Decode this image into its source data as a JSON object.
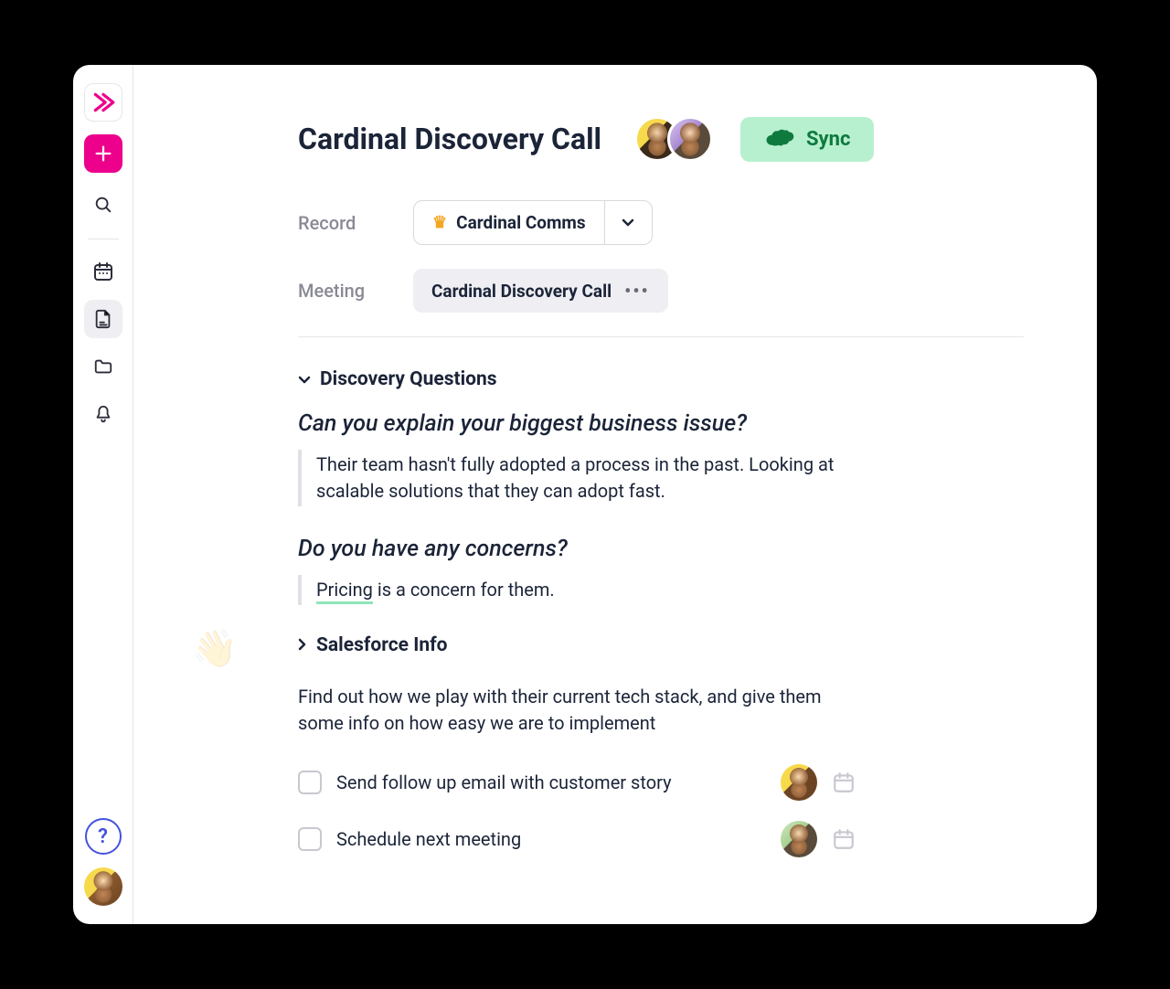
{
  "page": {
    "title": "Cardinal Discovery Call"
  },
  "sync": {
    "label": "Sync"
  },
  "meta": {
    "record_label": "Record",
    "record_value": "Cardinal Comms",
    "meeting_label": "Meeting",
    "meeting_value": "Cardinal Discovery Call"
  },
  "sections": {
    "discovery": {
      "title": "Discovery Questions",
      "q1": "Can you explain your biggest business issue?",
      "a1": "Their team hasn't fully adopted a process in the past. Looking at scalable solutions that they can adopt fast.",
      "q2": "Do you have any concerns?",
      "a2_highlight": "Pricing",
      "a2_rest": " is a concern for them."
    },
    "salesforce": {
      "title": "Salesforce Info"
    }
  },
  "note": "Find out how we play with their current tech stack, and give them some info on how easy we are to implement",
  "tasks": [
    {
      "label": "Send follow up email with customer story"
    },
    {
      "label": "Schedule next meeting"
    }
  ],
  "icons": {
    "logo": "app-logo",
    "plus": "plus",
    "search": "search",
    "calendar": "calendar",
    "document": "document",
    "folder": "folder",
    "bell": "bell",
    "help": "help",
    "crown": "crown",
    "chevron_down": "chevron-down",
    "chevron_right": "chevron-right",
    "more": "more",
    "cloud": "salesforce-cloud"
  }
}
